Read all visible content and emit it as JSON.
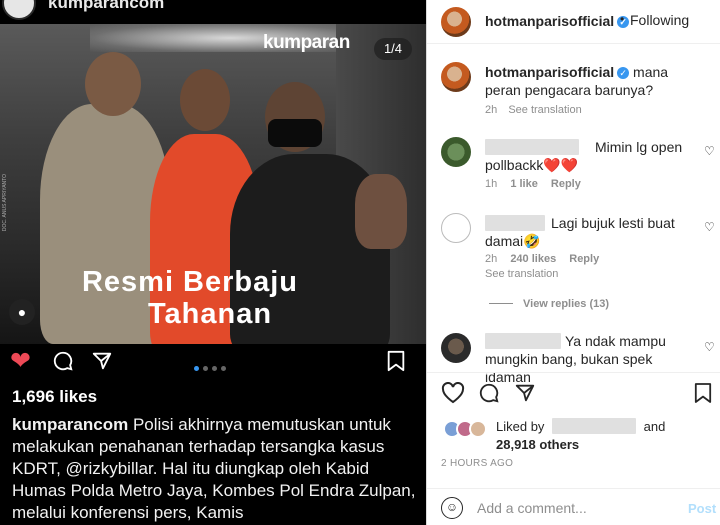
{
  "left": {
    "account": "kumparancom",
    "brand": "kumparan",
    "counter": "1/4",
    "headline_line1": "Resmi Berbaju",
    "headline_line2": "Tahanan",
    "photo_credit": "DOC. ANUS APRIYANTO",
    "likes": "1,696 likes",
    "caption_user": "kumparancom",
    "caption_text": "Polisi akhirnya memutuskan untuk melakukan penahanan terhadap tersangka kasus KDRT, @rizkybillar. Hal itu diungkap oleh Kabid Humas Polda Metro Jaya, Kombes Pol Endra Zulpan, melalui konferensi pers, Kamis",
    "carousel_dots": 4,
    "carousel_active": 1
  },
  "right": {
    "header": {
      "username": "hotmanparisofficial",
      "separator": "•",
      "follow": "Following",
      "more": "•••"
    },
    "caption": {
      "username": "hotmanparisofficial",
      "text": "mana peran pengacara barunya?",
      "time": "2h",
      "see_translation": "See translation"
    },
    "comments": [
      {
        "text": "Mimin lg open pollbackk❤️❤️",
        "time": "1h",
        "likes": "1 like",
        "reply": "Reply"
      },
      {
        "text": "Lagi bujuk lesti buat damai🤣",
        "time": "2h",
        "likes": "240 likes",
        "reply": "Reply",
        "see_translation": "See translation"
      },
      {
        "text": "Ya ndak mampu mungkin bang, bukan spek idaman"
      }
    ],
    "view_replies": "View replies (13)",
    "liked_by_prefix": "Liked by",
    "liked_by_and": "and",
    "liked_by_others": "28,918 others",
    "time_ago": "2 HOURS AGO",
    "add_comment_placeholder": "Add a comment...",
    "post_label": "Post"
  },
  "colors": {
    "accent": "#3897f0",
    "like_red": "#ed4956",
    "muted": "#8e8e8e"
  }
}
